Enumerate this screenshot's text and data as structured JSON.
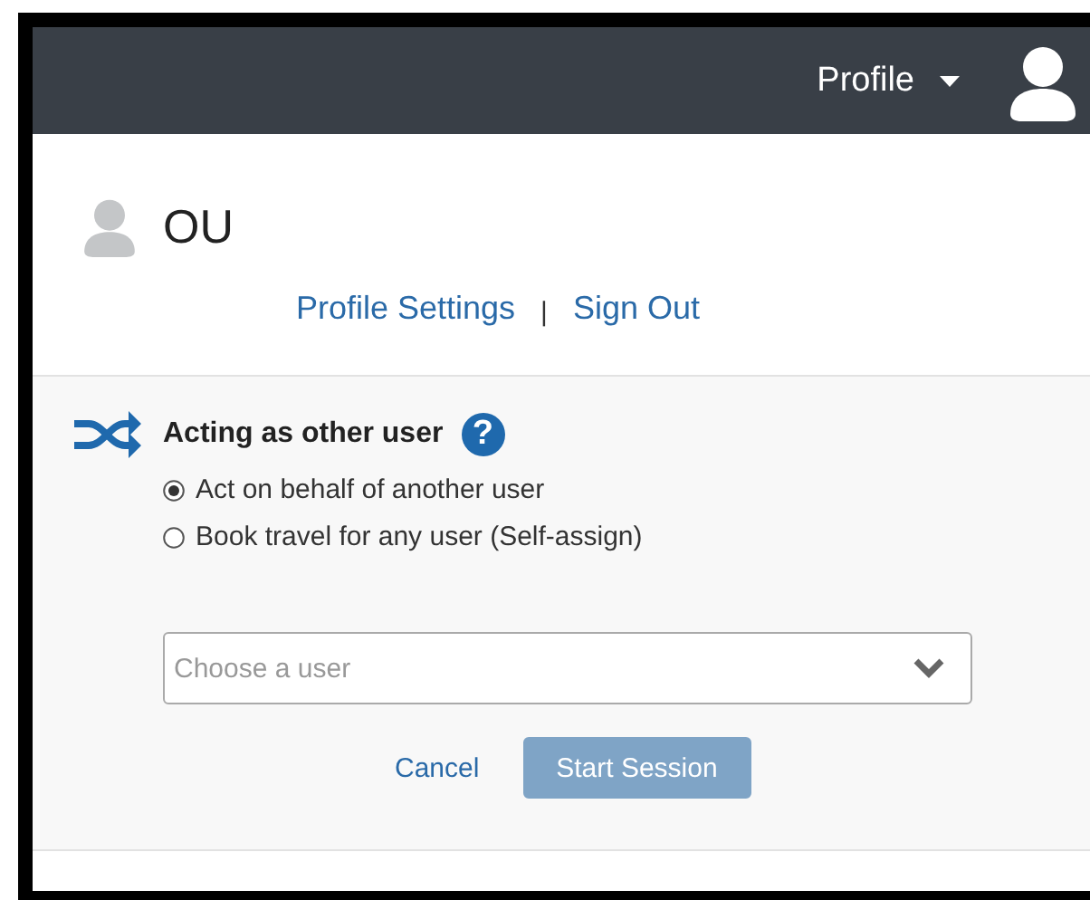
{
  "header": {
    "menu_label": "Profile"
  },
  "user": {
    "name": "OU"
  },
  "links": [
    {
      "label": "Profile Settings"
    },
    {
      "label": "Sign Out"
    }
  ],
  "link_separator": "|",
  "acting": {
    "title": "Acting as other user",
    "help": "?",
    "options": [
      {
        "label": "Act on behalf of another user",
        "selected": true
      },
      {
        "label": "Book travel for any user (Self-assign)",
        "selected": false
      }
    ],
    "user_select": {
      "placeholder": "Choose a user"
    },
    "cancel": {
      "label": "Cancel"
    },
    "start": {
      "label": "Start Session",
      "disabled": true
    }
  }
}
